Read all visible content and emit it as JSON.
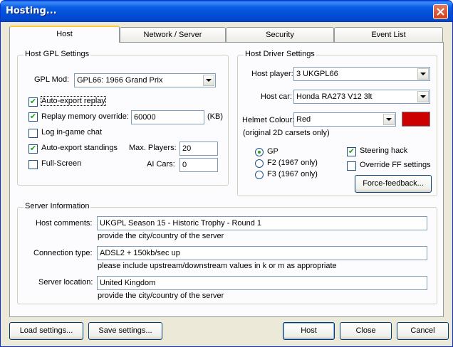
{
  "window": {
    "title": "Hosting...",
    "accent": "#0a5de4"
  },
  "tabs": [
    {
      "label": "Host",
      "active": true
    },
    {
      "label": "Network / Server",
      "active": false
    },
    {
      "label": "Security",
      "active": false
    },
    {
      "label": "Event List",
      "active": false
    }
  ],
  "host_gpl": {
    "title": "Host GPL Settings",
    "gpl_mod_label": "GPL Mod:",
    "gpl_mod_value": "GPL66: 1966 Grand Prix",
    "auto_export_replay": {
      "label": "Auto-export replay",
      "checked": true
    },
    "replay_memory": {
      "label": "Replay memory override:",
      "checked": true,
      "value": "60000",
      "unit": "(KB)"
    },
    "log_chat": {
      "label": "Log in-game chat",
      "checked": false
    },
    "auto_export_standings": {
      "label": "Auto-export standings",
      "checked": true
    },
    "full_screen": {
      "label": "Full-Screen",
      "checked": false
    },
    "max_players_label": "Max. Players:",
    "max_players_value": "20",
    "ai_cars_label": "AI Cars:",
    "ai_cars_value": "0"
  },
  "host_driver": {
    "title": "Host Driver Settings",
    "player_label": "Host player:",
    "player_value": "3 UKGPL66",
    "car_label": "Host car:",
    "car_value": "Honda RA273 V12 3lt",
    "helmet_label": "Helmet Colour:",
    "helmet_value": "Red",
    "helmet_color": "#cc0000",
    "carsets_note": "(original 2D carsets only)",
    "class_options": [
      {
        "label": "GP",
        "selected": true
      },
      {
        "label": "F2 (1967 only)",
        "selected": false
      },
      {
        "label": "F3 (1967 only)",
        "selected": false
      }
    ],
    "steering_hack": {
      "label": "Steering hack",
      "checked": true
    },
    "override_ff": {
      "label": "Override FF settings",
      "checked": false
    },
    "force_feedback_button": "Force-feedback..."
  },
  "server_info": {
    "title": "Server Information",
    "comments_label": "Host comments:",
    "comments_value": "UKGPL Season 15 - Historic Trophy - Round 1",
    "comments_hint": "provide the city/country of the server",
    "connection_label": "Connection type:",
    "connection_value": "ADSL2 + 150kb/sec up",
    "connection_hint": "please include upstream/downstream values in k or m as appropriate",
    "location_label": "Server location:",
    "location_value": "United Kingdom",
    "location_hint": "provide the city/country of the server"
  },
  "buttons": {
    "load": "Load settings...",
    "save": "Save settings...",
    "host": "Host",
    "close": "Close",
    "cancel": "Cancel"
  }
}
